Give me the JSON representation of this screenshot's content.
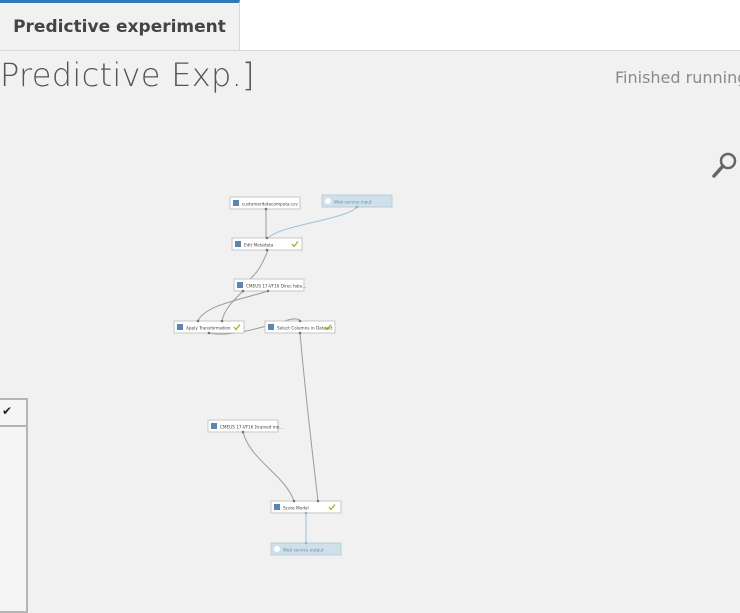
{
  "tab": {
    "label": "Predictive experiment"
  },
  "title": "Predictive Exp.]",
  "status": "Finished running",
  "icons": {
    "zoom": "magnify-icon",
    "panel_check": "check-icon"
  },
  "colors": {
    "accent": "#2f7ab8",
    "check": "#7fba00",
    "webservice": "#cfe0ea",
    "edge": "#9b9b9b",
    "webservice_edge": "#9cc4d8"
  },
  "modules": [
    {
      "id": "m1",
      "label": "customerdatacomputa.csv",
      "check": false,
      "webservice": false
    },
    {
      "id": "m2",
      "label": "Web service input",
      "check": false,
      "webservice": true
    },
    {
      "id": "m3",
      "label": "Edit Metadata",
      "check": true,
      "webservice": false
    },
    {
      "id": "m4",
      "label": "CMEUS 17-VF16 Direc fabu...",
      "check": false,
      "webservice": false
    },
    {
      "id": "m5",
      "label": "Apply Transformation",
      "check": true,
      "webservice": false
    },
    {
      "id": "m6",
      "label": "Select Columns in Dataset",
      "check": true,
      "webservice": false
    },
    {
      "id": "m7",
      "label": "CMEUS 17-VF16 [trained mo...",
      "check": false,
      "webservice": false
    },
    {
      "id": "m8",
      "label": "Score Model",
      "check": true,
      "webservice": false
    },
    {
      "id": "m9",
      "label": "Web service output",
      "check": false,
      "webservice": true
    }
  ]
}
